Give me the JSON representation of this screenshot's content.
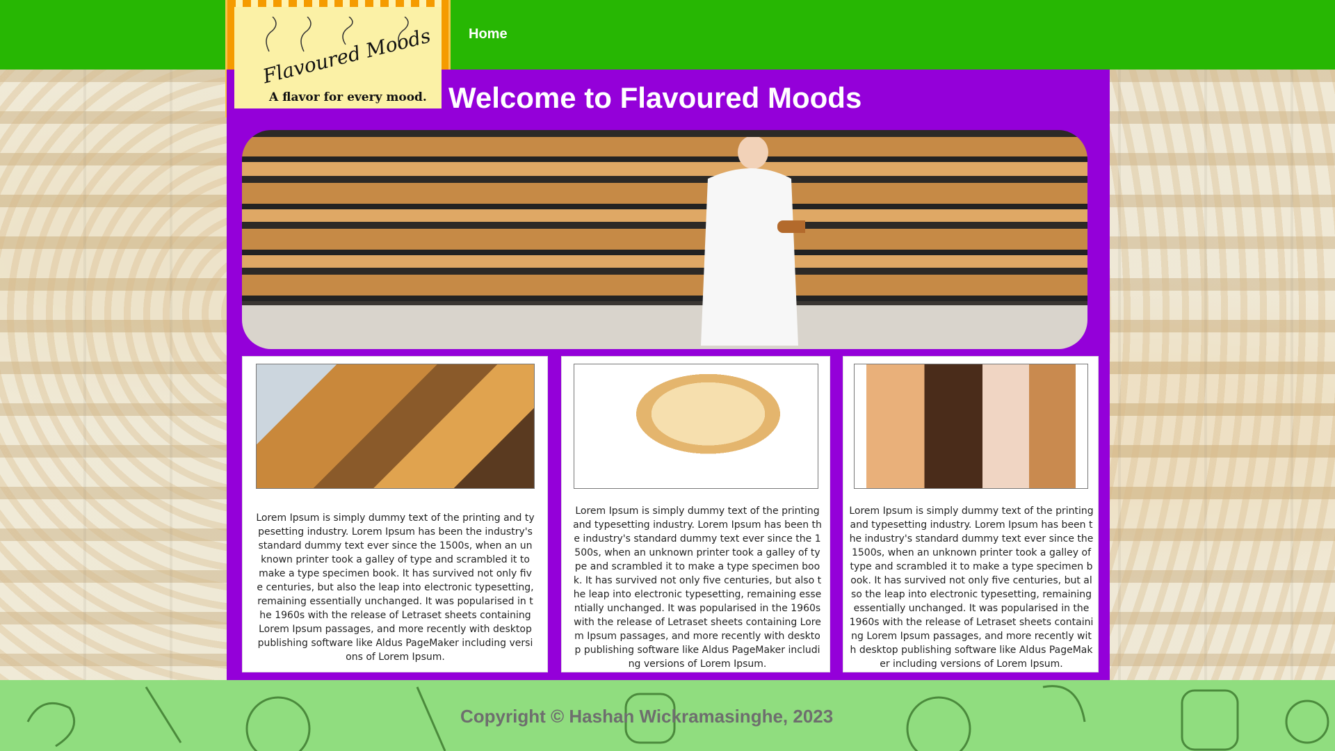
{
  "nav": {
    "logo": {
      "title": "Flavoured Moods",
      "tagline": "A flavor for every mood."
    },
    "items": [
      {
        "label": "Home"
      }
    ]
  },
  "main": {
    "title": "Welcome to Flavoured Moods",
    "cards": [
      {
        "text": "Lorem Ipsum is simply dummy text of the printing and typesetting industry. Lorem Ipsum has been the industry's standard dummy text ever since the 1500s, when an unknown printer took a galley of type and scrambled it to make a type specimen book. It has survived not only five centuries, but also the leap into electronic typesetting, remaining essentially unchanged. It was popularised in the 1960s with the release of Letraset sheets containing Lorem Ipsum passages, and more recently with desktop publishing software like Aldus PageMaker including versions of Lorem Ipsum."
      },
      {
        "text": "Lorem Ipsum is simply dummy text of the printing and typesetting industry. Lorem Ipsum has been the industry's standard dummy text ever since the 1500s, when an unknown printer took a galley of type and scrambled it to make a type specimen book. It has survived not only five centuries, but also the leap into electronic typesetting, remaining essentially unchanged. It was popularised in the 1960s with the release of Letraset sheets containing Lorem Ipsum passages, and more recently with desktop publishing software like Aldus PageMaker including versions of Lorem Ipsum."
      },
      {
        "text": "Lorem Ipsum is simply dummy text of the printing and typesetting industry. Lorem Ipsum has been the industry's standard dummy text ever since the 1500s, when an unknown printer took a galley of type and scrambled it to make a type specimen book. It has survived not only five centuries, but also the leap into electronic typesetting, remaining essentially unchanged. It was popularised in the 1960s with the release of Letraset sheets containing Lorem Ipsum passages, and more recently with desktop publishing software like Aldus PageMaker including versions of Lorem Ipsum."
      }
    ]
  },
  "footer": {
    "copyright": "Copyright © Hashan Wickramasinghe, 2023"
  },
  "colors": {
    "nav": "#27b703",
    "main": "#9400d9",
    "footer": "#90dd7f"
  }
}
